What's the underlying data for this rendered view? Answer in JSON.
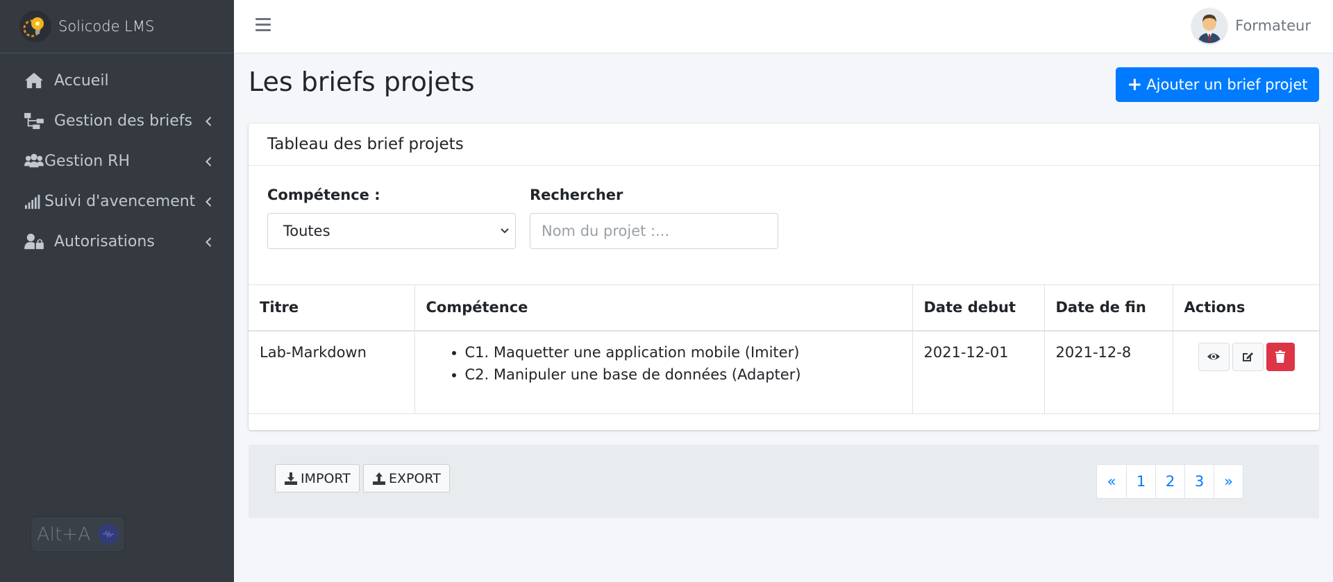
{
  "brand": {
    "name": "Solicode LMS"
  },
  "sidebar": {
    "items": [
      {
        "label": "Accueil",
        "icon": "home-icon"
      },
      {
        "label": "Gestion des briefs",
        "icon": "sitemap-icon"
      },
      {
        "label": "Gestion RH",
        "icon": "users-icon"
      },
      {
        "label": "Suivi d'avencement",
        "icon": "signal-icon"
      },
      {
        "label": "Autorisations",
        "icon": "user-lock-icon"
      }
    ]
  },
  "shortcut": {
    "label": "Alt+A"
  },
  "topbar": {
    "user": "Formateur"
  },
  "page": {
    "title": "Les briefs projets",
    "add_button": "Ajouter un brief projet"
  },
  "card": {
    "title": "Tableau des brief projets",
    "filters": {
      "competence_label": "Compétence :",
      "competence_value": "Toutes",
      "search_label": "Rechercher",
      "search_placeholder": "Nom du projet :..."
    },
    "table": {
      "headers": [
        "Titre",
        "Compétence",
        "Date debut",
        "Date de fin",
        "Actions"
      ],
      "rows": [
        {
          "titre": "Lab-Markdown",
          "competences": [
            "C1. Maquetter une application mobile (Imiter)",
            "C2. Manipuler une base de données (Adapter)"
          ],
          "date_debut": "2021-12-01",
          "date_fin": "2021-12-8"
        }
      ]
    }
  },
  "footer": {
    "import_label": "IMPORT",
    "export_label": "EXPORT",
    "pagination": [
      "«",
      "1",
      "2",
      "3",
      "»"
    ]
  },
  "colors": {
    "primary": "#007bff",
    "danger": "#dc3545",
    "sidebar": "#343a40"
  }
}
